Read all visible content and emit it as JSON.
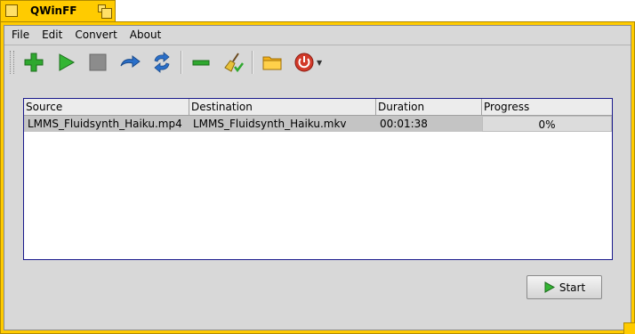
{
  "window": {
    "title": "QWinFF"
  },
  "menu": [
    "File",
    "Edit",
    "Convert",
    "About"
  ],
  "toolbar": {
    "buttons": [
      "add",
      "start",
      "stop",
      "retry",
      "retry-all",
      "remove",
      "clear-list",
      "open-output-folder",
      "poweroff"
    ],
    "icons": [
      "plus-icon",
      "play-icon",
      "stop-icon",
      "redo-icon",
      "refresh-icon",
      "minus-icon",
      "broom-icon",
      "folder-icon",
      "power-icon"
    ]
  },
  "table": {
    "columns": [
      "Source",
      "Destination",
      "Duration",
      "Progress"
    ],
    "rows": [
      {
        "source": "LMMS_Fluidsynth_Haiku.mp4",
        "destination": "LMMS_Fluidsynth_Haiku.mkv",
        "duration": "00:01:38",
        "progress": "0%",
        "progress_value": 0
      }
    ]
  },
  "buttons": {
    "start_label": "Start"
  },
  "colors": {
    "title_tab": "#ffcb00",
    "selection": "#c4c4c4",
    "accent_green": "#2fa82f",
    "accent_blue": "#2a6fc9"
  }
}
